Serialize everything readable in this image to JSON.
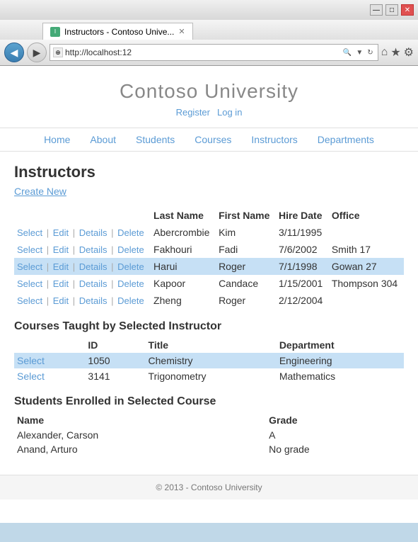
{
  "browser": {
    "title_bar": {
      "min_label": "—",
      "max_label": "□",
      "close_label": "✕"
    },
    "tab": {
      "icon_text": "I",
      "label": "Instructors - Contoso Unive...",
      "close": "✕"
    },
    "address_bar": {
      "icon": "⊕",
      "url": "http://localhost:12",
      "search_icon": "🔍",
      "refresh_icon": "↻",
      "stop_icon": "✕"
    },
    "nav": {
      "back": "◀",
      "forward": "▶",
      "home": "⌂",
      "star": "★",
      "gear": "⚙"
    }
  },
  "page": {
    "site_title": "Contoso University",
    "auth": {
      "register": "Register",
      "login": "Log in"
    },
    "nav_items": [
      "Home",
      "About",
      "Students",
      "Courses",
      "Instructors",
      "Departments"
    ],
    "heading": "Instructors",
    "create_new": "Create New",
    "instructors_table": {
      "headers": [
        "",
        "Last Name",
        "First Name",
        "Hire Date",
        "Office"
      ],
      "rows": [
        {
          "actions": [
            "Select",
            "Edit",
            "Details",
            "Delete"
          ],
          "last_name": "Abercrombie",
          "first_name": "Kim",
          "hire_date": "3/11/1995",
          "office": "",
          "selected": false
        },
        {
          "actions": [
            "Select",
            "Edit",
            "Details",
            "Delete"
          ],
          "last_name": "Fakhouri",
          "first_name": "Fadi",
          "hire_date": "7/6/2002",
          "office": "Smith 17",
          "selected": false
        },
        {
          "actions": [
            "Select",
            "Edit",
            "Details",
            "Delete"
          ],
          "last_name": "Harui",
          "first_name": "Roger",
          "hire_date": "7/1/1998",
          "office": "Gowan 27",
          "selected": true
        },
        {
          "actions": [
            "Select",
            "Edit",
            "Details",
            "Delete"
          ],
          "last_name": "Kapoor",
          "first_name": "Candace",
          "hire_date": "1/15/2001",
          "office": "Thompson 304",
          "selected": false
        },
        {
          "actions": [
            "Select",
            "Edit",
            "Details",
            "Delete"
          ],
          "last_name": "Zheng",
          "first_name": "Roger",
          "hire_date": "2/12/2004",
          "office": "",
          "selected": false
        }
      ]
    },
    "courses_section": {
      "title": "Courses Taught by Selected Instructor",
      "headers": [
        "ID",
        "Title",
        "Department"
      ],
      "rows": [
        {
          "id": "1050",
          "title": "Chemistry",
          "department": "Engineering",
          "selected": true
        },
        {
          "id": "3141",
          "title": "Trigonometry",
          "department": "Mathematics",
          "selected": false
        }
      ],
      "select_label": "Select"
    },
    "students_section": {
      "title": "Students Enrolled in Selected Course",
      "headers": [
        "Name",
        "Grade"
      ],
      "rows": [
        {
          "name": "Alexander, Carson",
          "grade": "A"
        },
        {
          "name": "Anand, Arturo",
          "grade": "No grade"
        }
      ]
    },
    "footer": "© 2013 - Contoso University"
  }
}
